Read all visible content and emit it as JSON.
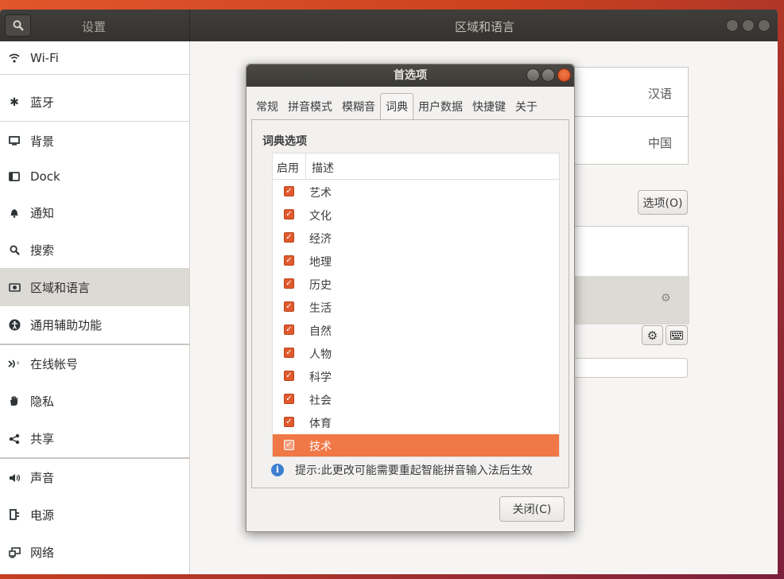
{
  "settings": {
    "app_title": "设置",
    "pane_title": "区域和语言"
  },
  "sidebar": {
    "items": [
      {
        "label": "Wi-Fi",
        "icon": "wifi-icon"
      },
      {
        "label": "蓝牙",
        "icon": "bluetooth-icon"
      },
      {
        "label": "背景",
        "icon": "background-icon"
      },
      {
        "label": "Dock",
        "icon": "dock-icon"
      },
      {
        "label": "通知",
        "icon": "bell-icon"
      },
      {
        "label": "搜索",
        "icon": "search-icon"
      },
      {
        "label": "区域和语言",
        "icon": "region-icon"
      },
      {
        "label": "通用辅助功能",
        "icon": "accessibility-icon"
      },
      {
        "label": "在线帐号",
        "icon": "online-accounts-icon"
      },
      {
        "label": "隐私",
        "icon": "hand-icon"
      },
      {
        "label": "共享",
        "icon": "share-icon"
      },
      {
        "label": "声音",
        "icon": "speaker-icon"
      },
      {
        "label": "电源",
        "icon": "power-plug-icon"
      },
      {
        "label": "网络",
        "icon": "network-icon"
      }
    ],
    "selected": "区域和语言"
  },
  "region": {
    "language_value": "汉语",
    "formats_value": "中国",
    "options_button": "选项(O)"
  },
  "dialog": {
    "title": "首选项",
    "tabs": [
      "常规",
      "拼音模式",
      "模糊音",
      "词典",
      "用户数据",
      "快捷键",
      "关于"
    ],
    "active_tab": "词典",
    "section_title": "词典选项",
    "columns": [
      "启用",
      "描述"
    ],
    "rows": [
      {
        "label": "艺术",
        "enabled": true
      },
      {
        "label": "文化",
        "enabled": true
      },
      {
        "label": "经济",
        "enabled": true
      },
      {
        "label": "地理",
        "enabled": true
      },
      {
        "label": "历史",
        "enabled": true
      },
      {
        "label": "生活",
        "enabled": true
      },
      {
        "label": "自然",
        "enabled": true
      },
      {
        "label": "人物",
        "enabled": true
      },
      {
        "label": "科学",
        "enabled": true
      },
      {
        "label": "社会",
        "enabled": true
      },
      {
        "label": "体育",
        "enabled": true
      },
      {
        "label": "技术",
        "enabled": true
      }
    ],
    "selected_row": "技术",
    "hint": "提示:此更改可能需要重起智能拼音输入法后生效",
    "close_button": "关闭(C)"
  },
  "colors": {
    "accent": "#f07746",
    "checkbox": "#e05a2d",
    "titlebar": "#3b3a36"
  }
}
